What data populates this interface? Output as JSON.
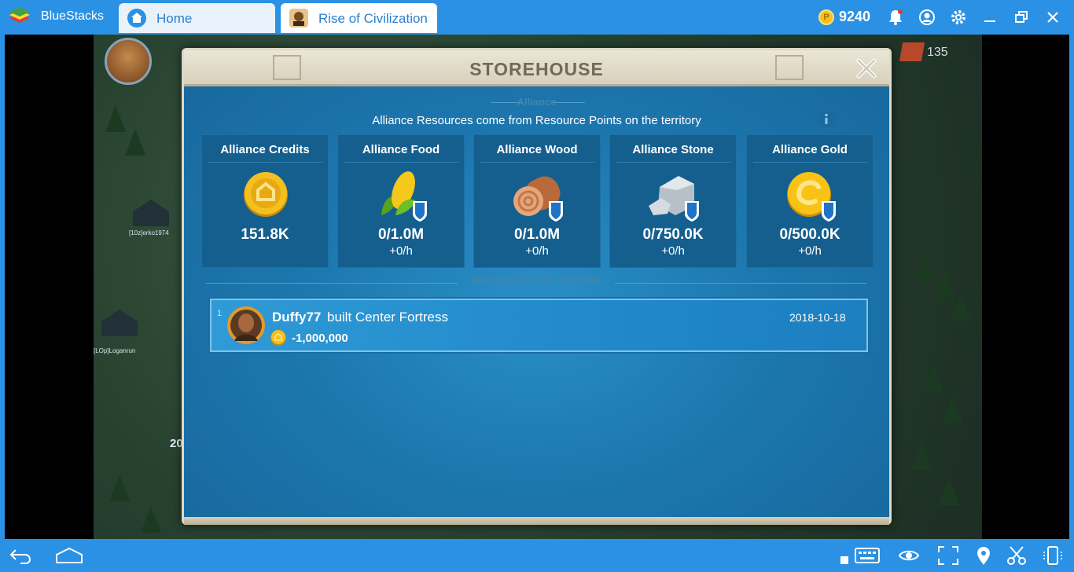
{
  "window": {
    "app_name": "BlueStacks",
    "tabs": [
      {
        "label": "Home"
      },
      {
        "label": "Rise of Civilizations"
      }
    ],
    "coins": "9240",
    "coin_symbol": "P"
  },
  "map": {
    "labels": [
      "[10z]erko1974",
      "[LOp]Loganrun"
    ],
    "top_resource_value": "135",
    "left_value": "20"
  },
  "storehouse": {
    "title": "STOREHOUSE",
    "section_alliance": "Alliance",
    "subtitle": "Alliance Resources come from Resource Points on the territory",
    "cards": [
      {
        "title": "Alliance Credits",
        "amount": "151.8K",
        "rate": "",
        "icon": "alliance-credit-coin-icon"
      },
      {
        "title": "Alliance Food",
        "amount": "0/1.0M",
        "rate": "+0/h",
        "icon": "corn-icon"
      },
      {
        "title": "Alliance Wood",
        "amount": "0/1.0M",
        "rate": "+0/h",
        "icon": "wood-log-icon"
      },
      {
        "title": "Alliance Stone",
        "amount": "0/750.0K",
        "rate": "+0/h",
        "icon": "stone-icon"
      },
      {
        "title": "Alliance Gold",
        "amount": "0/500.0K",
        "rate": "+0/h",
        "icon": "gold-coin-icon"
      }
    ],
    "section_use": "Resource Use Details",
    "log": [
      {
        "index": "1",
        "player": "Duffy77",
        "action": "built Center Fortress",
        "date": "2018-10-18",
        "amount": "-1,000,000"
      }
    ]
  }
}
